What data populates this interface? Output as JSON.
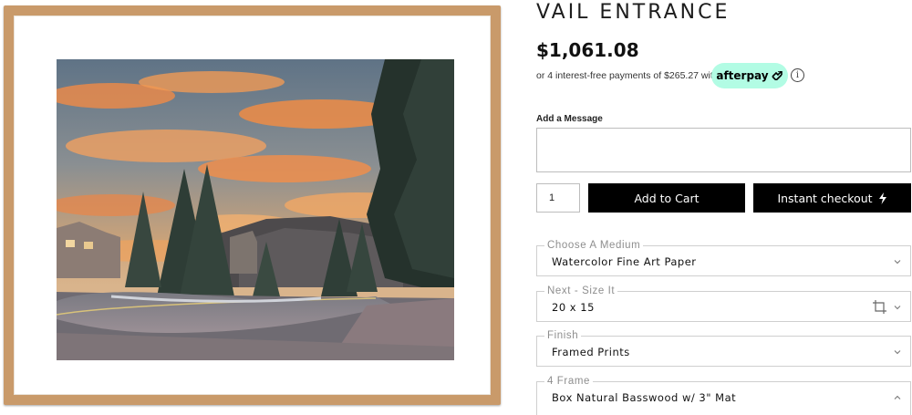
{
  "product": {
    "title": "VAIL ENTRANCE",
    "price": "$1,061.08"
  },
  "installments": {
    "text": "or 4 interest-free payments of $265.27 with",
    "provider": "afterpay",
    "provider_color": "#b2fce4"
  },
  "message": {
    "label": "Add a Message",
    "value": ""
  },
  "cart": {
    "quantity": "1",
    "add_to_cart_label": "Add to Cart",
    "instant_checkout_label": "Instant checkout"
  },
  "options": [
    {
      "label": "Choose A Medium",
      "value": "Watercolor Fine Art Paper",
      "icon": "chevron-down-icon"
    },
    {
      "label": "Next - Size It",
      "value": "20 x 15",
      "icon": "chevron-down-icon"
    },
    {
      "label": "Finish",
      "value": "Framed Prints",
      "icon": "chevron-down-icon"
    },
    {
      "label": "4 Frame",
      "value": "Box Natural Basswood w/ 3\" Mat",
      "icon": "chevron-up-icon"
    }
  ],
  "colors": {
    "frame": "#c99a6a",
    "button_bg": "#000000"
  }
}
